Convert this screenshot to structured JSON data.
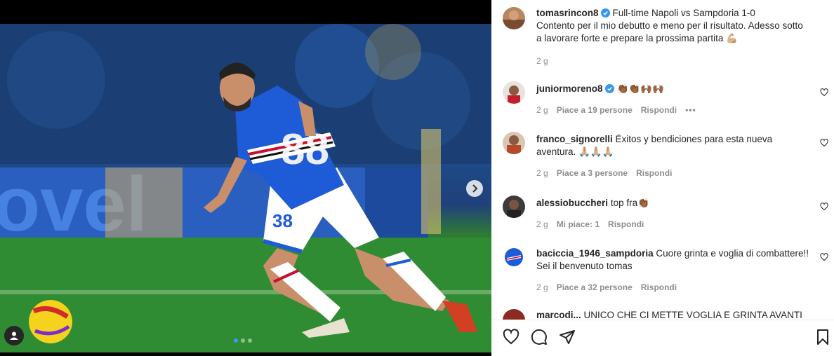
{
  "post": {
    "author": "tomasrincon8",
    "caption": "Full-time Napoli vs Sampdoria 1-0",
    "caption_body": "Contento per il mio debutto e meno per il risultato. Adesso sotto a lavorare forte e prepare la prossima partita 💪🏼",
    "time": "2 g",
    "jersey_number": "88",
    "shorts_number": "38",
    "pagination": {
      "total": 3,
      "active": 0
    }
  },
  "comments": [
    {
      "user": "juniormoreno8",
      "verified": true,
      "text": "👏🏾👏🏾🙌🏾🙌🏾",
      "time": "2 g",
      "likes": "Piace a 19 persone",
      "reply": "Rispondi",
      "more": "•••"
    },
    {
      "user": "franco_signorelli",
      "verified": false,
      "text": "Éxitos y bendiciones para esta nueva aventura. 🙏🏼🙏🏼🙏🏼",
      "time": "2 g",
      "likes": "Piace a 3 persone",
      "reply": "Rispondi"
    },
    {
      "user": "alessiobuccheri",
      "verified": false,
      "text": "top fra👏🏾",
      "time": "2 g",
      "likes": "Mi piace: 1",
      "reply": "Rispondi"
    },
    {
      "user": "baciccia_1946_sampdoria",
      "verified": false,
      "text": "Cuore grinta e voglia di combattere!! Sei il benvenuto tomas",
      "time": "2 g",
      "likes": "Piace a 32 persone",
      "reply": "Rispondi"
    },
    {
      "user": "marcodi...",
      "verified": false,
      "text": "UNICO CHE CI METTE VOGLIA E GRINTA AVANTI"
    }
  ],
  "icons": {
    "like": "heart-icon",
    "comment": "comment-icon",
    "share": "share-icon",
    "save": "bookmark-icon",
    "next": "chevron-right-icon",
    "tags": "user-tag-icon"
  },
  "colors": {
    "verified": "#3897f0",
    "secondary_text": "#8e8e8e",
    "jersey_blue": "#1e5bd6"
  }
}
